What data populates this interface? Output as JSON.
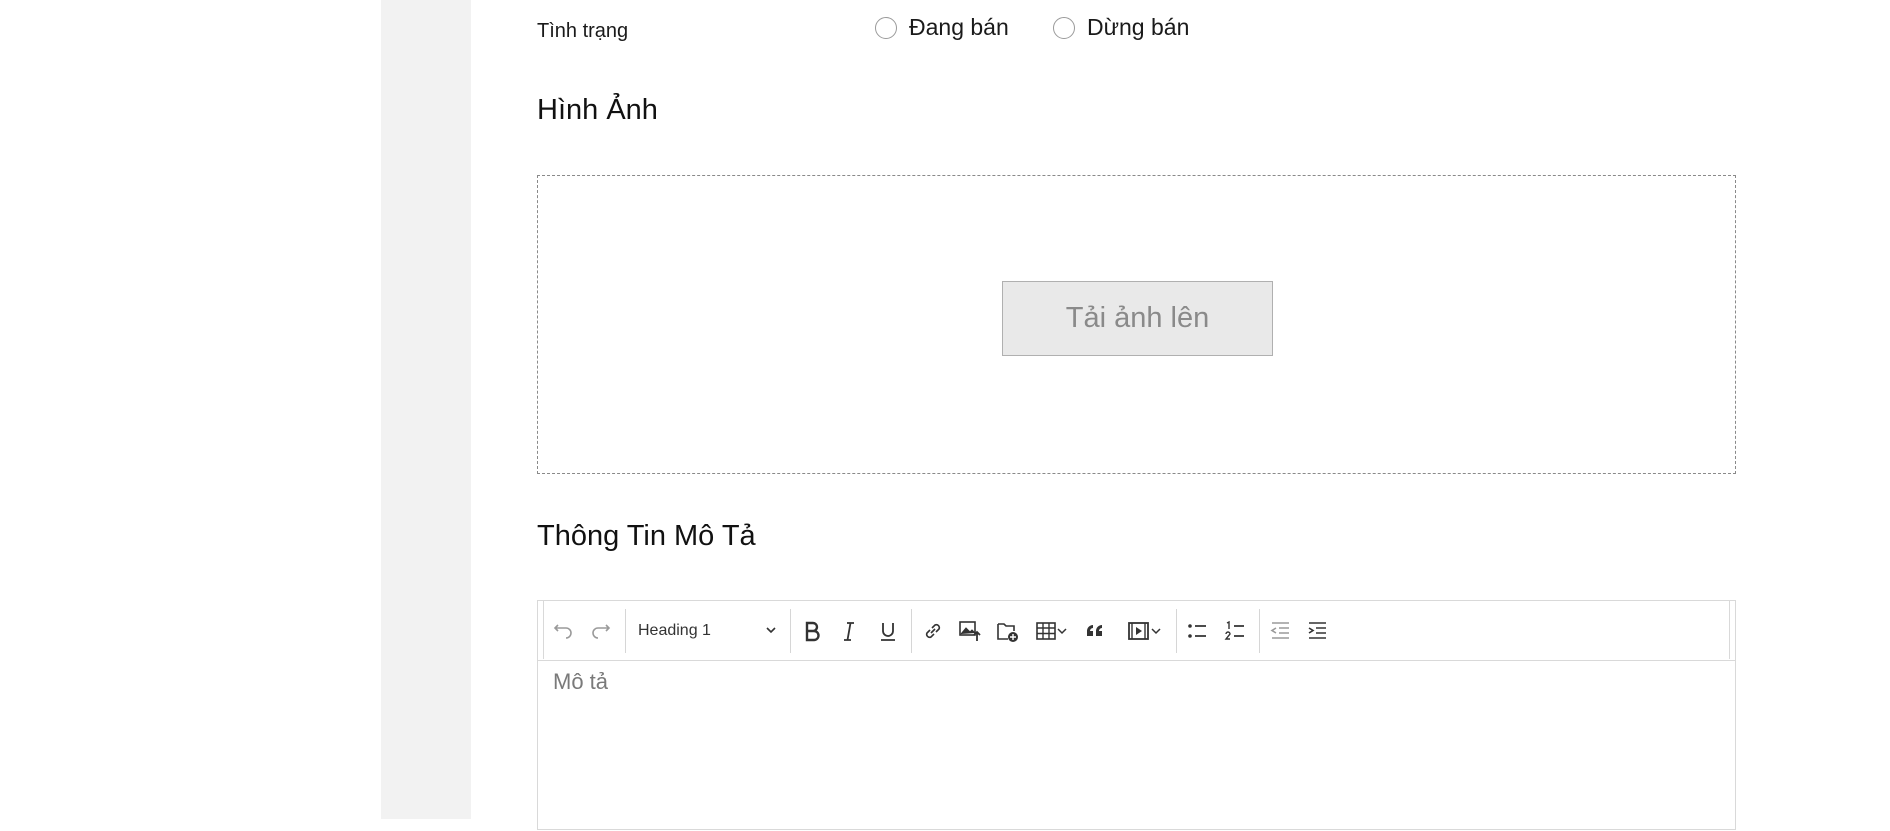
{
  "status": {
    "label": "Tình trạng",
    "options": [
      {
        "label": "Đang bán",
        "selected": false
      },
      {
        "label": "Dừng bán",
        "selected": false
      }
    ]
  },
  "images": {
    "title": "Hình Ảnh",
    "upload_label": "Tải ảnh lên"
  },
  "description": {
    "title": "Thông Tin Mô Tả",
    "placeholder": "Mô tả",
    "heading_select": "Heading 1"
  },
  "toolbar_icons": [
    "undo-icon",
    "redo-icon",
    "bold-icon",
    "italic-icon",
    "underline-icon",
    "link-icon",
    "image-upload-icon",
    "media-folder-icon",
    "table-icon",
    "blockquote-icon",
    "media-embed-icon",
    "bulleted-list-icon",
    "numbered-list-icon",
    "outdent-icon",
    "indent-icon"
  ],
  "colors": {
    "page_bg": "#ffffff",
    "panel_bg": "#f2f2f2",
    "border": "#d9d9d9",
    "upload_button_bg": "#e9e9e9",
    "muted_text": "#8a8a8a"
  }
}
